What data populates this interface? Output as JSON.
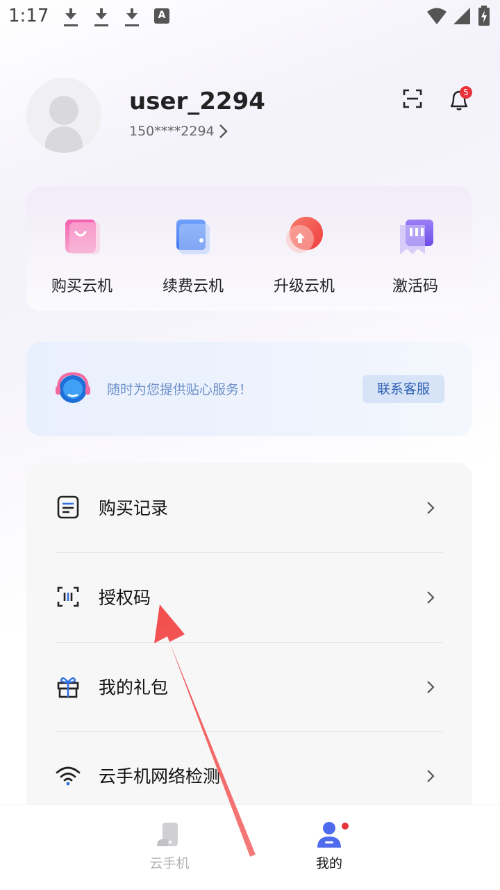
{
  "status_bar": {
    "time": "1:17",
    "icons": [
      "download-icon",
      "download-icon",
      "download-icon",
      "a-box-icon",
      "wifi-icon",
      "cellular-icon",
      "battery-icon"
    ],
    "a_box_text": "A"
  },
  "profile": {
    "username": "user_2294",
    "phone": "150****2294",
    "notification_count": "5"
  },
  "quick_actions": [
    {
      "label": "购买云机",
      "icon": "shopping-bag-icon",
      "color": "#f0479a"
    },
    {
      "label": "续费云机",
      "icon": "wallet-icon",
      "color": "#4f86f7"
    },
    {
      "label": "升级云机",
      "icon": "upgrade-icon",
      "color": "#f0564f"
    },
    {
      "label": "激活码",
      "icon": "ticket-icon",
      "color": "#7b5cf0"
    }
  ],
  "service": {
    "text": "随时为您提供贴心服务！",
    "button": "联系客服"
  },
  "menu": [
    {
      "label": "购买记录",
      "icon": "document-icon"
    },
    {
      "label": "授权码",
      "icon": "scan-code-icon"
    },
    {
      "label": "我的礼包",
      "icon": "gift-icon"
    },
    {
      "label": "云手机网络检测",
      "icon": "wifi-icon"
    }
  ],
  "bottom_nav": [
    {
      "label": "云手机",
      "icon": "cloud-phone-icon",
      "active": false
    },
    {
      "label": "我的",
      "icon": "user-icon",
      "active": true
    }
  ],
  "colors": {
    "accent": "#4f6bed",
    "badge": "#e8333a",
    "annotation": "#f05a5a"
  }
}
